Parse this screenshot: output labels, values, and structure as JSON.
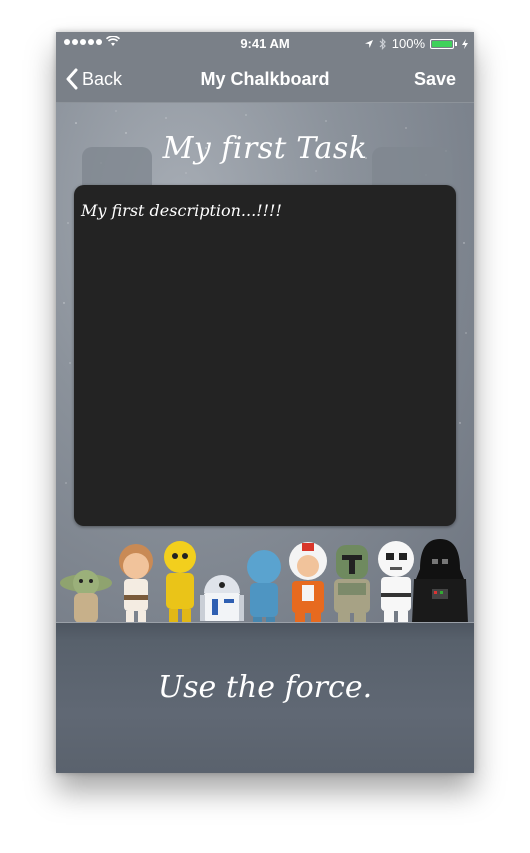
{
  "status_bar": {
    "time": "9:41 AM",
    "battery": "100%",
    "icons": [
      "signal-dots-icon",
      "wifi-icon",
      "location-icon",
      "bluetooth-icon",
      "battery-icon",
      "charging-icon"
    ]
  },
  "nav": {
    "back_label": "Back",
    "title": "My Chalkboard",
    "save_label": "Save"
  },
  "task": {
    "title": "My first Task",
    "description": "My first description...!!!!"
  },
  "characters": [
    "yoda",
    "luke-skywalker",
    "c-3po",
    "r2-d2",
    "hologram-figure",
    "rebel-pilot",
    "boba-fett",
    "stormtrooper",
    "darth-vader"
  ],
  "footer": {
    "motto": "Use the force."
  },
  "colors": {
    "bar": "#7a8088",
    "chalkboard": "#232323",
    "battery": "#3fd15b"
  }
}
